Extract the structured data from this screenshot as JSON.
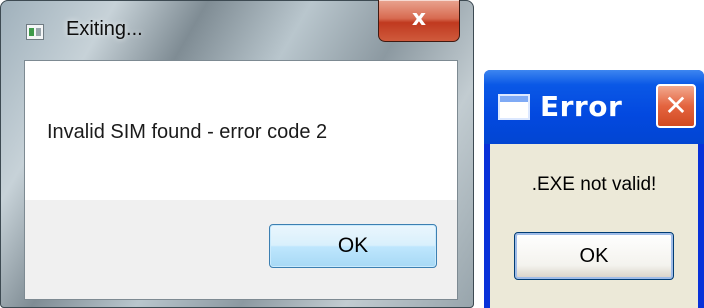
{
  "dialog_exiting": {
    "title": "Exiting...",
    "message": "Invalid SIM found - error code 2",
    "ok_label": "OK",
    "close_glyph": "x",
    "app_icon": "application-window-icon",
    "accent": "#3c7fb1"
  },
  "dialog_error": {
    "title": "Error",
    "message": ".EXE not valid!",
    "ok_label": "OK",
    "close_glyph": "✕",
    "window_icon": "window-icon",
    "titlebar_color": "#0349e0",
    "close_color": "#e4643f"
  }
}
